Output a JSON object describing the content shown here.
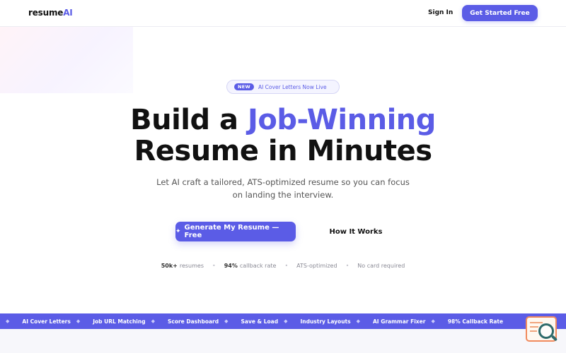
{
  "nav": {
    "logo_main": "resume",
    "logo_accent": "AI",
    "signin": "Sign In",
    "get_started": "Get Started Free"
  },
  "hero": {
    "badge": "NEW",
    "announcement": "AI Cover Letters Now Live",
    "headline_part1": "Build a ",
    "headline_highlight": "Job-Winning",
    "headline_part2": "Resume in Minutes",
    "subtitle": "Let AI craft a tailored, ATS-optimized resume so you can focus on landing the interview.",
    "cta_icon": "✦",
    "cta_primary": "Generate My Resume — Free",
    "cta_secondary": "How It Works"
  },
  "stats": [
    {
      "value": "50k+",
      "label": "resumes"
    },
    {
      "value": "94%",
      "label": "callback rate"
    },
    {
      "value": "",
      "label": "ATS-optimized"
    },
    {
      "value": "",
      "label": "No card required"
    }
  ],
  "ticker": [
    "AI Cover Letters",
    "Job URL Matching",
    "Score Dashboard",
    "Save & Load",
    "Industry Layouts",
    "AI Grammar Fixer",
    "98% Callback Rate"
  ],
  "ticker_separator": "◆",
  "colors": {
    "accent": "#5b5ce6",
    "text": "#111111",
    "muted": "#555555"
  },
  "icons": {
    "cta": "sparkle-icon",
    "helper": "resume-search-icon"
  }
}
